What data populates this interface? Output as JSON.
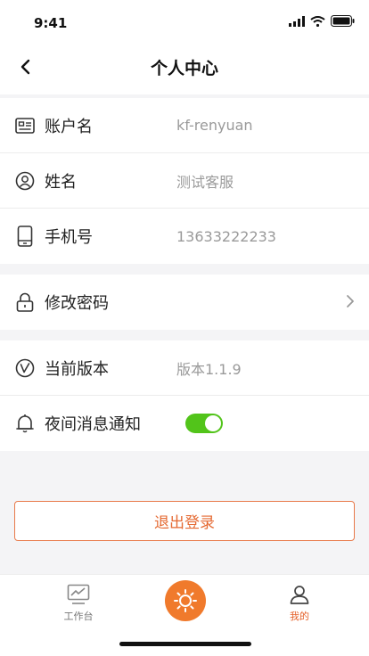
{
  "status": {
    "time": "9:41"
  },
  "header": {
    "title": "个人中心"
  },
  "profile": {
    "account_label": "账户名",
    "account_value": "kf-renyuan",
    "name_label": "姓名",
    "name_value": "测试客服",
    "phone_label": "手机号",
    "phone_value": "13633222233"
  },
  "security": {
    "change_password_label": "修改密码"
  },
  "settings": {
    "version_label": "当前版本",
    "version_value": "版本1.1.9",
    "night_notify_label": "夜间消息通知",
    "night_notify_on": true
  },
  "logout_label": "退出登录",
  "tabbar": {
    "workbench_label": "工作台",
    "mine_label": "我的"
  },
  "colors": {
    "accent": "#e5612a",
    "toggle_on": "#52c41a",
    "center_button": "#f07a2c"
  }
}
